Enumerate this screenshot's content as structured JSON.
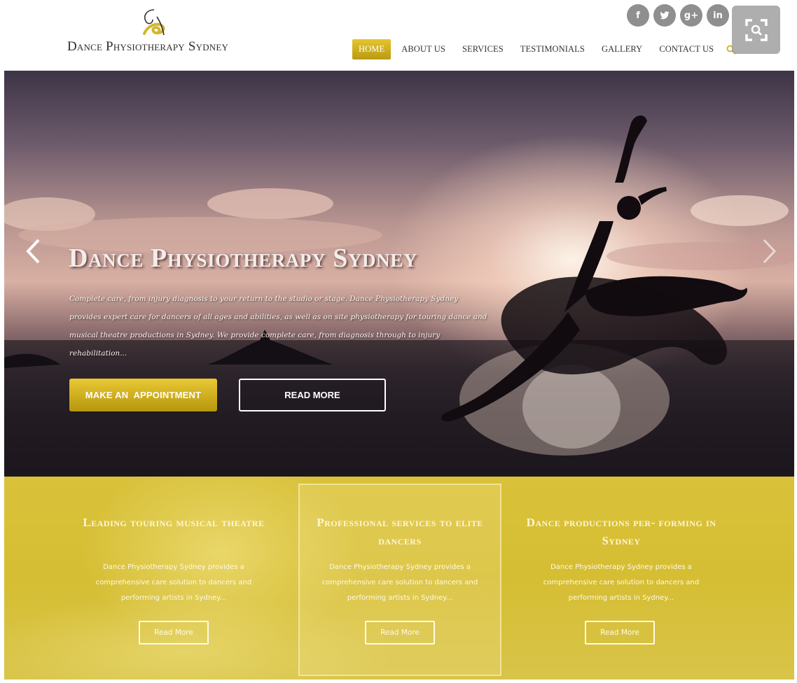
{
  "site": {
    "name": "Dance Physiotherapy Sydney",
    "colors": {
      "gold": "#d4b62c",
      "gold_dark": "#b7960d",
      "text_dark": "#2e2e2e",
      "social_gray": "#8f8f8f"
    }
  },
  "social": [
    {
      "icon": "facebook-icon",
      "glyph": "f"
    },
    {
      "icon": "twitter-icon",
      "glyph": "t"
    },
    {
      "icon": "google-plus-icon",
      "glyph": "g+"
    },
    {
      "icon": "linkedin-icon",
      "glyph": "in"
    }
  ],
  "nav": {
    "items": [
      "HOME",
      "ABOUT US",
      "SERVICES",
      "TESTIMONIALS",
      "GALLERY",
      "CONTACT US"
    ],
    "active": "HOME",
    "search_icon": "search-icon"
  },
  "hero": {
    "title": "Dance Physiotherapy Sydney",
    "text": "Complete care, from injury diagnosis to your return to the studio or stage. Dance Physiotherapy Sydney provides expert care for dancers of all ages and abilities, as well as on site physiotherapy for touring dance and musical theatre productions in Sydney. We provide complete care, from diagnosis through to injury rehabilitation...",
    "primary_button": "MAKE AN  APPOINTMENT",
    "secondary_button": "READ MORE",
    "prev_icon": "chevron-left-icon",
    "next_icon": "chevron-right-icon"
  },
  "services": [
    {
      "title": "Leading touring musical theatre",
      "text": "Dance Physiotherapy Sydney provides a comprehensive care solution to dancers and performing artists in Sydney...",
      "button": "Read More"
    },
    {
      "title": "Professional services to elite dancers",
      "text": "Dance Physiotherapy Sydney provides a comprehensive care solution to dancers and performing artists in Sydney...",
      "button": "Read More"
    },
    {
      "title": "Dance productions per- forming in Sydney",
      "text": "Dance Physiotherapy Sydney provides a comprehensive care solution to dancers and performing artists in Sydney...",
      "button": "Read More"
    }
  ],
  "overlay": {
    "expand_icon": "expand-search-icon"
  }
}
